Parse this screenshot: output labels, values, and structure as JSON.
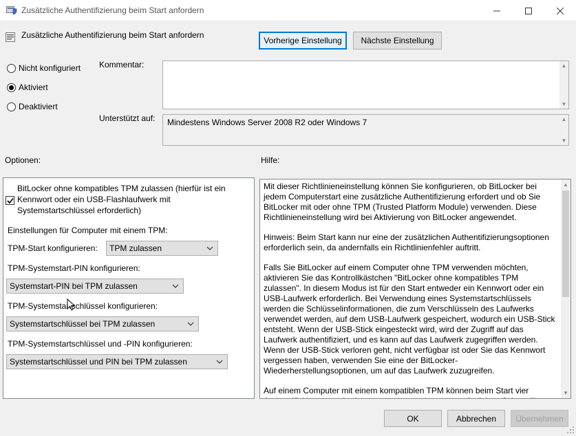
{
  "window": {
    "title": "Zusätzliche Authentifizierung beim Start anfordern"
  },
  "header": {
    "policy_name": "Zusätzliche Authentifizierung beim Start anfordern",
    "prev_button": "Vorherige Einstellung",
    "next_button": "Nächste Einstellung"
  },
  "state": {
    "options": [
      {
        "label": "Nicht konfiguriert",
        "checked": false
      },
      {
        "label": "Aktiviert",
        "checked": true
      },
      {
        "label": "Deaktiviert",
        "checked": false
      }
    ]
  },
  "comment": {
    "label": "Kommentar:",
    "value": ""
  },
  "supported": {
    "label": "Unterstützt auf:",
    "value": "Mindestens Windows Server 2008 R2 oder Windows 7"
  },
  "options_section": {
    "label": "Optionen:",
    "allow_without_tpm": {
      "checked": true,
      "line1": "BitLocker ohne kompatibles TPM zulassen (hierfür ist ein",
      "line2": "Kennwort oder ein USB-Flashlaufwerk mit",
      "line3": "Systemstartschlüssel erforderlich)"
    },
    "tpm_settings_heading": "Einstellungen für Computer mit einem TPM:",
    "tpm_start": {
      "label": "TPM-Start konfigurieren:",
      "value": "TPM zulassen"
    },
    "tpm_pin": {
      "label": "TPM-Systemstart-PIN konfigurieren:",
      "value": "Systemstart-PIN bei TPM zulassen"
    },
    "tpm_key": {
      "label": "TPM-Systemstartschlüssel konfigurieren:",
      "value": "Systemstartschlüssel bei TPM zulassen"
    },
    "tpm_key_pin": {
      "label": "TPM-Systemstartschlüssel und -PIN konfigurieren:",
      "value": "Systemstartschlüssel und PIN bei TPM zulassen"
    }
  },
  "help_section": {
    "label": "Hilfe:",
    "paragraphs": [
      "Mit dieser Richtlinieneinstellung können Sie konfigurieren, ob BitLocker bei jedem Computerstart eine zusätzliche Authentifizierung erfordert und ob Sie BitLocker mit oder ohne TPM (Trusted Platform Module) verwenden. Diese Richtlinieneinstellung wird bei Aktivierung von BitLocker angewendet.",
      "Hinweis: Beim Start kann nur eine der zusätzlichen Authentifizierungsoptionen erforderlich sein, da andernfalls ein Richtlinienfehler auftritt.",
      "Falls Sie BitLocker auf einem Computer ohne TPM verwenden möchten, aktivieren Sie das Kontrollkästchen \"BitLocker ohne kompatibles TPM zulassen\". In diesem Modus ist für den Start entweder ein Kennwort oder ein USB-Laufwerk erforderlich. Bei Verwendung eines Systemstartschlüssels werden die Schlüsselinformationen, die zum Verschlüsseln des Laufwerks verwendet werden, auf dem USB-Laufwerk gespeichert, wodurch ein USB-Stick entsteht. Wenn der USB-Stick eingesteckt wird, wird der Zugriff auf das Laufwerk authentifiziert, und es kann auf das Laufwerk zugegriffen werden. Wenn der USB-Stick verloren geht, nicht verfügbar ist oder Sie das Kennwort vergessen haben, verwenden Sie eine der BitLocker-Wiederherstellungsoptionen, um auf das Laufwerk zuzugreifen.",
      "Auf einem Computer mit einem kompatiblen TPM können beim Start vier Authentifizierungsmethoden verwendet werden, um zusätzlichen Schutz für"
    ]
  },
  "footer": {
    "ok": "OK",
    "cancel": "Abbrechen",
    "apply": "Übernehmen"
  },
  "icons": {
    "app": "policy-shield-icon",
    "header": "policy-setting-icon"
  },
  "colors": {
    "focus_border": "#0078d7"
  }
}
